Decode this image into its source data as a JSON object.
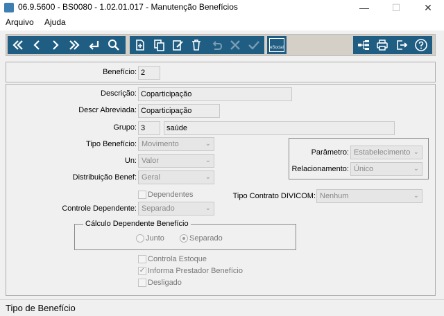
{
  "window": {
    "title": "06.9.5600 - BS0080 - 1.02.01.017 - Manutenção Benefícios",
    "minimize": "—",
    "maximize": "☐",
    "close": "✕"
  },
  "menu": [
    "Arquivo",
    "Ajuda"
  ],
  "toolbar": {
    "nav": [
      "first-icon",
      "previous-icon",
      "next-icon",
      "last-icon",
      "goto-icon",
      "search-icon"
    ],
    "edit": [
      "add-icon",
      "copy-icon",
      "edit-icon",
      "delete-icon",
      "undo-icon",
      "cancel-icon",
      "save-icon"
    ],
    "esocial_label": "eSocial",
    "right": [
      "hierarchy-icon",
      "print-icon",
      "exit-icon",
      "help-icon"
    ]
  },
  "form": {
    "beneficio_label": "Benefício:",
    "beneficio_value": "2",
    "descricao_label": "Descrição:",
    "descricao_value": "Coparticipação",
    "descr_abrev_label": "Descr Abreviada:",
    "descr_abrev_value": "Coparticipação",
    "grupo_label": "Grupo:",
    "grupo_code": "3",
    "grupo_desc": "saúde",
    "tipo_beneficio_label": "Tipo Benefício:",
    "tipo_beneficio_value": "Movimento",
    "un_label": "Un:",
    "un_value": "Valor",
    "distribuicao_label": "Distribuição Benef:",
    "distribuicao_value": "Geral",
    "dependentes_label": "Dependentes",
    "controle_dep_label": "Controle Dependente:",
    "controle_dep_value": "Separado",
    "parametro_label": "Parâmetro:",
    "parametro_value": "Estabelecimento",
    "relacionamento_label": "Relacionamento:",
    "relacionamento_value": "Único",
    "tipo_contrato_label": "Tipo Contrato DIVICOM:",
    "tipo_contrato_value": "Nenhum",
    "calculo_title": "Cálculo Dependente Benefício",
    "radio_junto": "Junto",
    "radio_separado": "Separado",
    "controla_estoque": "Controla Estoque",
    "informa_prestador": "Informa Prestador Benefício",
    "desligado": "Desligado"
  },
  "status": "Tipo de Benefício"
}
